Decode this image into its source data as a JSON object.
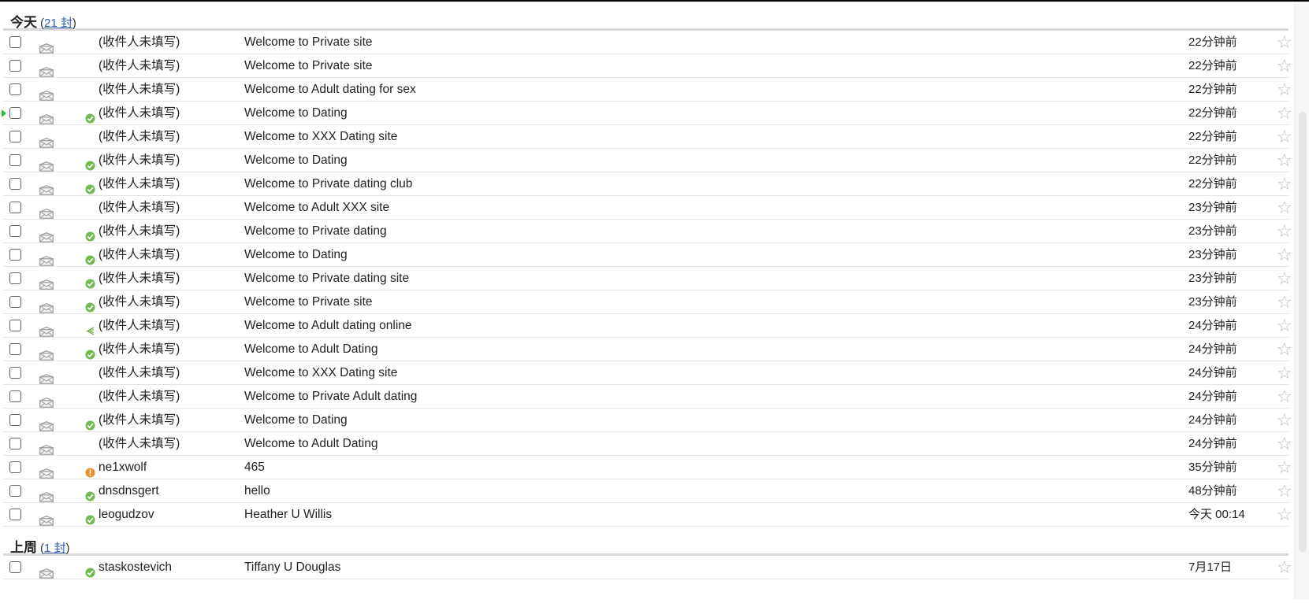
{
  "groups": [
    {
      "label": "今天",
      "count_label": "21 封",
      "rows": [
        {
          "sender": "(收件人未填写)",
          "subject": "Welcome to Private site",
          "time": "22分钟前",
          "status": "none",
          "active": false
        },
        {
          "sender": "(收件人未填写)",
          "subject": "Welcome to Private site",
          "time": "22分钟前",
          "status": "none",
          "active": false
        },
        {
          "sender": "(收件人未填写)",
          "subject": "Welcome to Adult dating for sex",
          "time": "22分钟前",
          "status": "none",
          "active": false
        },
        {
          "sender": "(收件人未填写)",
          "subject": "Welcome to Dating",
          "time": "22分钟前",
          "status": "sent",
          "active": true
        },
        {
          "sender": "(收件人未填写)",
          "subject": "Welcome to XXX Dating site",
          "time": "22分钟前",
          "status": "none",
          "active": false
        },
        {
          "sender": "(收件人未填写)",
          "subject": "Welcome to Dating",
          "time": "22分钟前",
          "status": "sent",
          "active": false
        },
        {
          "sender": "(收件人未填写)",
          "subject": "Welcome to Private dating club",
          "time": "22分钟前",
          "status": "sent",
          "active": false
        },
        {
          "sender": "(收件人未填写)",
          "subject": "Welcome to Adult XXX site",
          "time": "23分钟前",
          "status": "none",
          "active": false
        },
        {
          "sender": "(收件人未填写)",
          "subject": "Welcome to Private dating",
          "time": "23分钟前",
          "status": "sent",
          "active": false
        },
        {
          "sender": "(收件人未填写)",
          "subject": "Welcome to Dating",
          "time": "23分钟前",
          "status": "sent",
          "active": false
        },
        {
          "sender": "(收件人未填写)",
          "subject": "Welcome to Private dating site",
          "time": "23分钟前",
          "status": "sent",
          "active": false
        },
        {
          "sender": "(收件人未填写)",
          "subject": "Welcome to Private site",
          "time": "23分钟前",
          "status": "sent",
          "active": false
        },
        {
          "sender": "(收件人未填写)",
          "subject": "Welcome to Adult dating online",
          "time": "24分钟前",
          "status": "sending",
          "active": false
        },
        {
          "sender": "(收件人未填写)",
          "subject": "Welcome to Adult Dating",
          "time": "24分钟前",
          "status": "sent",
          "active": false
        },
        {
          "sender": "(收件人未填写)",
          "subject": "Welcome to XXX Dating site",
          "time": "24分钟前",
          "status": "none",
          "active": false
        },
        {
          "sender": "(收件人未填写)",
          "subject": "Welcome to Private Adult dating",
          "time": "24分钟前",
          "status": "none",
          "active": false
        },
        {
          "sender": "(收件人未填写)",
          "subject": "Welcome to Dating",
          "time": "24分钟前",
          "status": "sent",
          "active": false
        },
        {
          "sender": "(收件人未填写)",
          "subject": "Welcome to Adult Dating",
          "time": "24分钟前",
          "status": "none",
          "active": false
        },
        {
          "sender": "ne1xwolf",
          "subject": "465",
          "time": "35分钟前",
          "status": "warning",
          "active": false
        },
        {
          "sender": "dnsdnsgert",
          "subject": "hello",
          "time": "48分钟前",
          "status": "sent",
          "active": false
        },
        {
          "sender": "leogudzov",
          "subject": "Heather U Willis",
          "time": "今天 00:14",
          "status": "sent",
          "active": false
        }
      ]
    },
    {
      "label": "上周",
      "count_label": "1 封",
      "rows": [
        {
          "sender": "staskostevich",
          "subject": "Tiffany U Douglas",
          "time": "7月17日",
          "status": "sent",
          "active": false
        }
      ]
    }
  ],
  "icons": {
    "envelope": "envelope-icon",
    "sent": "sent-check-icon",
    "sending": "sending-icon",
    "warning": "warning-icon",
    "star": "star-icon"
  },
  "colors": {
    "sent_green": "#6fb94f",
    "warning_orange": "#e8912c",
    "marker_green": "#3bbb3b",
    "link_blue": "#2a5db0"
  }
}
